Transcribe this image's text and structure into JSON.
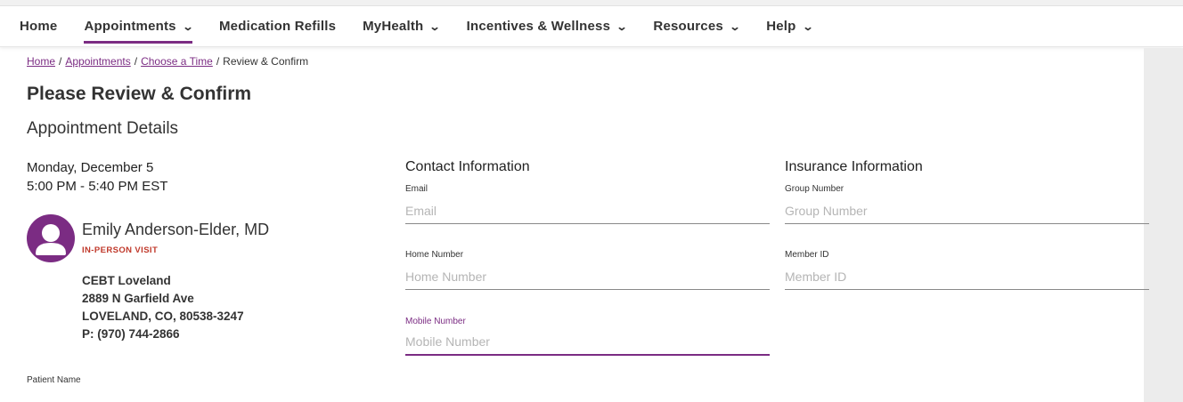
{
  "nav": {
    "items": [
      {
        "label": "Home",
        "has_dropdown": false,
        "active": false
      },
      {
        "label": "Appointments",
        "has_dropdown": true,
        "active": true
      },
      {
        "label": "Medication Refills",
        "has_dropdown": false,
        "active": false
      },
      {
        "label": "MyHealth",
        "has_dropdown": true,
        "active": false
      },
      {
        "label": "Incentives & Wellness",
        "has_dropdown": true,
        "active": false
      },
      {
        "label": "Resources",
        "has_dropdown": true,
        "active": false
      },
      {
        "label": "Help",
        "has_dropdown": true,
        "active": false
      }
    ],
    "chevron": "⌄"
  },
  "breadcrumb": {
    "home": "Home",
    "appointments": "Appointments",
    "choose_time": "Choose a Time",
    "current": "Review & Confirm",
    "separator": "/"
  },
  "page_title": "Please Review & Confirm",
  "section_title": "Appointment Details",
  "appointment": {
    "date": "Monday, December 5",
    "time": "5:00 PM - 5:40 PM EST"
  },
  "provider": {
    "name": "Emily Anderson-Elder, MD",
    "visit_type": "IN-PERSON VISIT",
    "location": "CEBT Loveland",
    "street": "2889 N Garfield Ave",
    "city": "LOVELAND, CO, 80538-3247",
    "phone": "P: (970) 744-2866",
    "avatar_icon": "person-icon"
  },
  "patient_name_label": "Patient Name",
  "contact": {
    "title": "Contact Information",
    "email_label": "Email",
    "email_placeholder": "Email",
    "home_label": "Home Number",
    "home_placeholder": "Home Number",
    "mobile_label": "Mobile Number",
    "mobile_placeholder": "Mobile Number"
  },
  "insurance": {
    "title": "Insurance Information",
    "group_label": "Group Number",
    "group_placeholder": "Group Number",
    "member_label": "Member ID",
    "member_placeholder": "Member ID"
  },
  "colors": {
    "brand": "#7b2c83",
    "visit_type": "#c0392b"
  }
}
